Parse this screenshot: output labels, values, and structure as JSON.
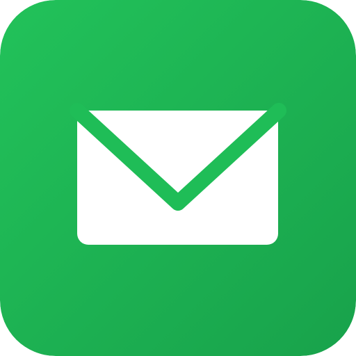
{
  "app_icon": {
    "name": "mail-app-icon",
    "icon": "mail-icon",
    "colors": {
      "background_top": "#22c25a",
      "background_bottom": "#18a24b",
      "envelope_body": "#ffffff",
      "envelope_flap_stroke": "#1fbd57"
    }
  }
}
